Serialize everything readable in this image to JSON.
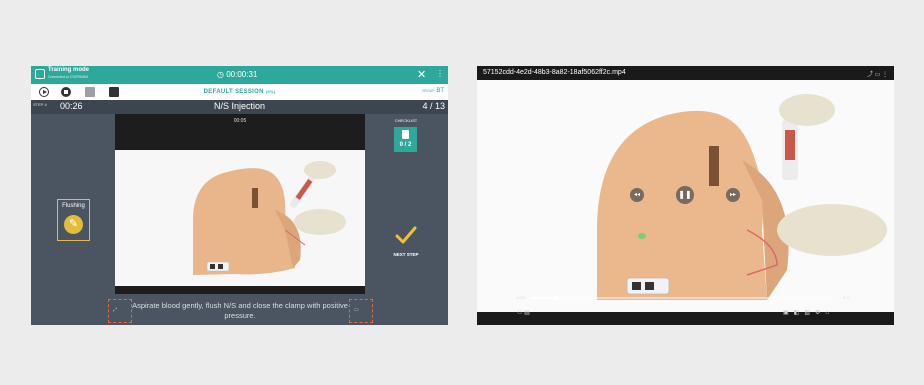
{
  "training_app": {
    "header": {
      "mode_title": "Training mode",
      "mode_subtitle": "Connected to CS2PSM00",
      "timer": "00:00:31",
      "menu_icon": "kebab-menu-icon",
      "close_icon": "close-icon"
    },
    "toolbar": {
      "session_label": "DEFAULT SESSION",
      "session_pct": "(0%)",
      "group_prefix": "GROUP",
      "group_value": "BT",
      "icons": [
        "play-icon",
        "stop-icon",
        "chart-icon",
        "image-icon"
      ]
    },
    "step": {
      "label": "STEP 4",
      "elapsed": "00:26",
      "title": "N/S Injection",
      "count": "4 / 13"
    },
    "video": {
      "time": "00:05"
    },
    "tool_card": {
      "label": "Flushing",
      "icon": "syringe-icon",
      "accent": "#e2bd3a"
    },
    "checklist": {
      "label": "CHECKLIST",
      "count": "0 / 2",
      "icon": "checklist-icon"
    },
    "next_step": {
      "label": "NEXT STEP",
      "icon": "checkmark-icon",
      "color": "#f2c12e"
    },
    "caption": {
      "text": "Aspirate blood gently, flush N/S and close the clamp with positive pressure."
    },
    "colors": {
      "teal": "#2ea89a",
      "panel": "#4a5561",
      "highlight": "#e8663d"
    }
  },
  "video_player": {
    "filename": "57152cdd-4e2d-48b3-8a82-18af5062ff2c.mp4",
    "progress_fraction": 0.08,
    "time_current": "0:00",
    "time_end": "0:11",
    "controls": [
      "rewind-icon",
      "pause-icon",
      "forward-icon"
    ]
  }
}
